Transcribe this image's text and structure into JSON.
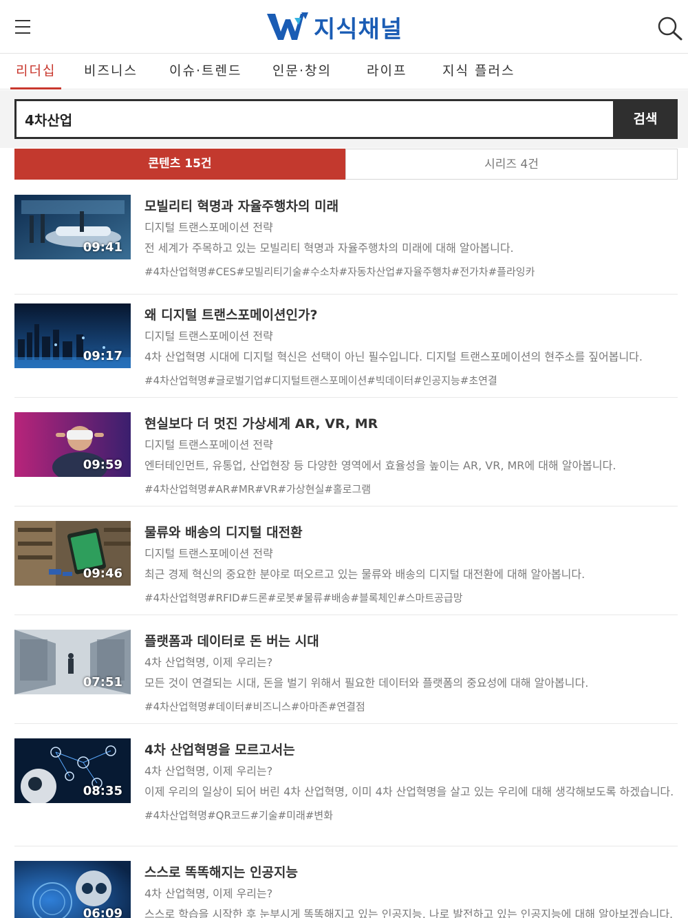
{
  "header": {
    "logo_text": "지식채널",
    "colors": {
      "brand_blue": "#1a5cb4",
      "accent_red": "#c3392e"
    }
  },
  "nav": {
    "items": [
      {
        "label": "리더십",
        "active": true
      },
      {
        "label": "비즈니스",
        "active": false
      },
      {
        "label": "이슈·트렌드",
        "active": false
      },
      {
        "label": "인문·창의",
        "active": false
      },
      {
        "label": "라이프",
        "active": false
      },
      {
        "label": "지식 플러스",
        "active": false
      }
    ]
  },
  "search": {
    "value": "4차산업",
    "button_label": "검색"
  },
  "tabs": {
    "contents_label": "콘텐츠 15건",
    "series_label": "시리즈 4건"
  },
  "items": [
    {
      "title": "모빌리티 혁명과 자율주행차의 미래",
      "series": "디지털 트랜스포메이션 전략",
      "desc": "전 세계가 주목하고 있는 모빌리티 혁명과 자율주행차의 미래에 대해 알아봅니다.",
      "tags": "#4차산업혁명#CES#모빌리티기술#수소차#자동차산업#자율주행차#전가차#플라잉카",
      "duration": "09:41"
    },
    {
      "title": "왜 디지털 트랜스포메이션인가?",
      "series": "디지털 트랜스포메이션 전략",
      "desc": "4차 산업혁명 시대에 디지털 혁신은 선택이 아닌 필수입니다. 디지털 트랜스포메이션의 현주소를 짚어봅니다.",
      "tags": "#4차산업혁명#글로벌기업#디지털트랜스포메이션#빅데이터#인공지능#초연결",
      "duration": "09:17"
    },
    {
      "title": "현실보다 더 멋진 가상세계 AR, VR, MR",
      "series": "디지털 트랜스포메이션 전략",
      "desc": "엔터테인먼트, 유통업, 산업현장 등 다양한 영역에서 효율성을 높이는 AR, VR, MR에 대해 알아봅니다.",
      "tags": "#4차산업혁명#AR#MR#VR#가상현실#홀로그램",
      "duration": "09:59"
    },
    {
      "title": "물류와 배송의 디지털 대전환",
      "series": "디지털 트랜스포메이션 전략",
      "desc": "최근 경제 혁신의 중요한 분야로 떠오르고 있는 물류와 배송의 디지털 대전환에 대해 알아봅니다.",
      "tags": "#4차산업혁명#RFID#드론#로봇#물류#배송#블록체인#스마트공급망",
      "duration": "09:46"
    },
    {
      "title": "플랫폼과 데이터로 돈 버는 시대",
      "series": "4차 산업혁명, 이제 우리는?",
      "desc": "모든 것이 연결되는 시대, 돈을 벌기 위해서 필요한 데이터와 플랫폼의 중요성에 대해 알아봅니다.",
      "tags": "#4차산업혁명#데이터#비즈니스#아마존#연결점",
      "duration": "07:51"
    },
    {
      "title": "4차 산업혁명을 모르고서는",
      "series": "4차 산업혁명, 이제 우리는?",
      "desc": "이제 우리의 일상이 되어 버린 4차 산업혁명, 이미 4차 산업혁명을 살고 있는 우리에 대해 생각해보도록 하겠습니다.",
      "tags": "#4차산업혁명#QR코드#기술#미래#변화",
      "duration": "08:35"
    },
    {
      "title": "스스로 똑똑해지는 인공지능",
      "series": "4차 산업혁명, 이제 우리는?",
      "desc": "스스로 학습을 시작한 후 눈부시게 똑똑해지고 있는 인공지능, 나로 발전하고 있는 인공지능에 대해 알아보겠습니다.",
      "tags": "",
      "duration": "06:09"
    }
  ]
}
